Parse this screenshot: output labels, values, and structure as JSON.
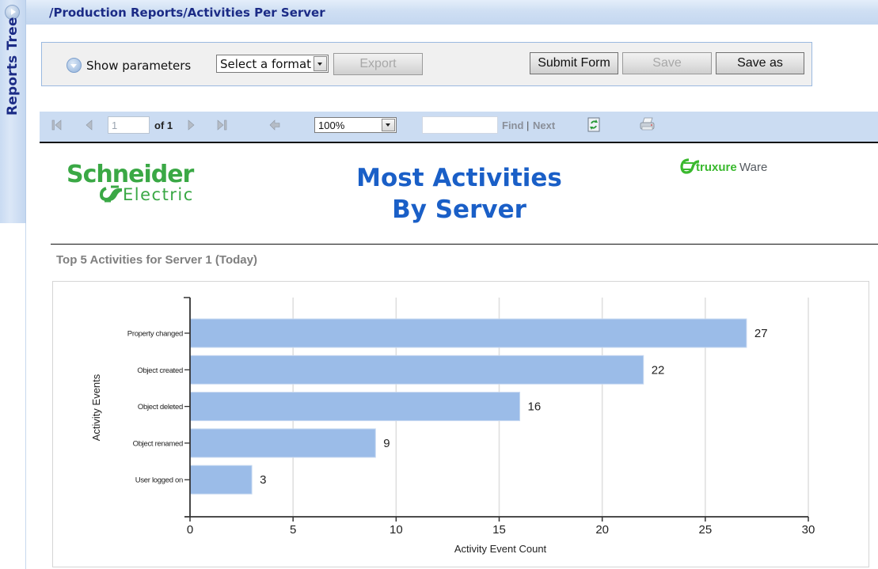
{
  "sidebar": {
    "label": "Reports Tree",
    "toggle_icon": "circle-play-icon"
  },
  "header": {
    "title": "/Production Reports/Activities Per Server"
  },
  "params": {
    "show_parameters_label": "Show parameters",
    "format_select": {
      "selected": "Select a format"
    },
    "export_label": "Export",
    "submit_label": "Submit Form",
    "save_label": "Save",
    "save_as_label": "Save as"
  },
  "toolbar": {
    "page_value": "1",
    "page_of": "of 1",
    "zoom_value": "100%",
    "find_value": "",
    "find_label": "Find",
    "separator": "|",
    "next_label": "Next",
    "icons": [
      "first-page-icon",
      "prev-page-icon",
      "next-page-icon",
      "last-page-icon",
      "back-icon",
      "refresh-icon",
      "print-icon"
    ]
  },
  "report": {
    "brand_logo": {
      "line1": "Schneider",
      "line2": "Electric"
    },
    "product_logo": {
      "part1": "truxure",
      "part2": "Ware"
    },
    "title_line1": "Most Activities",
    "title_line2": "By Server",
    "chart_subtitle": "Top 5 Activities for Server 1 (Today)"
  },
  "chart_data": {
    "type": "bar",
    "orientation": "horizontal",
    "title": "Top 5 Activities for Server 1 (Today)",
    "categories": [
      "Property changed",
      "Object created",
      "Object deleted",
      "Object renamed",
      "User logged on"
    ],
    "values": [
      27,
      22,
      16,
      9,
      3
    ],
    "data_labels": [
      "27",
      "22",
      "16",
      "9",
      "3"
    ],
    "xlabel": "Activity Event Count",
    "ylabel": "Activity Events",
    "xlim": [
      0,
      30
    ],
    "xticks": [
      0,
      5,
      10,
      15,
      20,
      25,
      30
    ],
    "grid": "vertical",
    "legend": "none",
    "bar_color": "#9bbce8"
  },
  "colors": {
    "header_text": "#1b2b86",
    "title_blue": "#1a5fc7",
    "schneider_green": "#3aa845",
    "struxure_green": "#3ab92e",
    "toolbar_bg": "#cbdcf2"
  }
}
